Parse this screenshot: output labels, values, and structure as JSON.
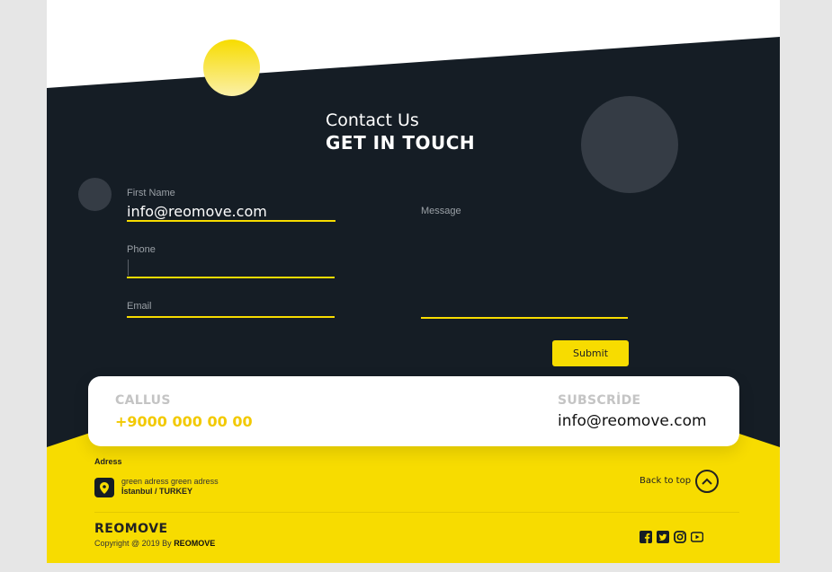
{
  "header": {
    "subtitle": "Contact Us",
    "title": "GET IN TOUCH"
  },
  "form": {
    "first_name": {
      "label": "First Name",
      "value": "info@reomove.com"
    },
    "phone": {
      "label": "Phone",
      "value": ""
    },
    "email": {
      "label": "Email",
      "value": ""
    },
    "message": {
      "label": "Message",
      "value": ""
    },
    "submit_label": "Submit"
  },
  "card": {
    "call_label": "CALLUS",
    "call_value": "+9000 000 00 00",
    "subscribe_label": "SUBSCRİDE",
    "subscribe_value": "info@reomove.com"
  },
  "footer": {
    "address_title": "Adress",
    "address_line1": "green adress green adress",
    "address_line2": "İstanbul / TURKEY",
    "back_to_top": "Back to top",
    "brand": "REOMOVE",
    "copyright_prefix": "Copyright @ 2019 By ",
    "copyright_brand": "REOMOVE",
    "social_icons": [
      "facebook-icon",
      "twitter-icon",
      "instagram-icon",
      "youtube-icon"
    ]
  },
  "colors": {
    "dark": "#151d25",
    "accent": "#f7dc00",
    "circle_gray": "#353c45"
  }
}
